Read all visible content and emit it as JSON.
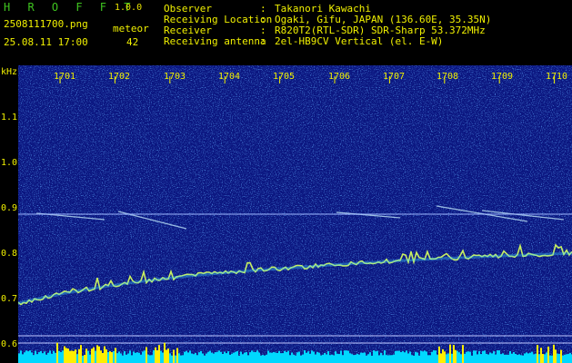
{
  "header": {
    "app_title": "H R O F F T",
    "version": "1.0.0",
    "filename": "2508111700.png",
    "timestamp": "25.08.11 17:00",
    "meteor_label": "meteor",
    "meteor_count": "42",
    "info": [
      {
        "label": "Observer",
        "value": "Takanori Kawachi"
      },
      {
        "label": "Receiving Location",
        "value": "Ogaki, Gifu, JAPAN (136.60E, 35.35N)"
      },
      {
        "label": "Receiver",
        "value": "R820T2(RTL-SDR) SDR-Sharp 53.372MHz"
      },
      {
        "label": "Receiving antenna",
        "value": "2el-HB9CV Vertical (el. E-W)"
      }
    ]
  },
  "axes": {
    "y_unit": "kHz",
    "y_ticks": [
      "1.1",
      "1.0",
      "0.9",
      "0.8",
      "0.7",
      "0.6"
    ],
    "x_ticks": [
      "1701",
      "1702",
      "1703",
      "1704",
      "1705",
      "1706",
      "1707",
      "1708",
      "1709",
      "1710"
    ]
  },
  "colors": {
    "text": "#f0f000",
    "title": "#3fc41f",
    "background": "#0b1680",
    "signal": "#c8f060",
    "carrier": "#a0c0ff",
    "level": "#00e0ff",
    "level_peak": "#ffee00"
  }
}
